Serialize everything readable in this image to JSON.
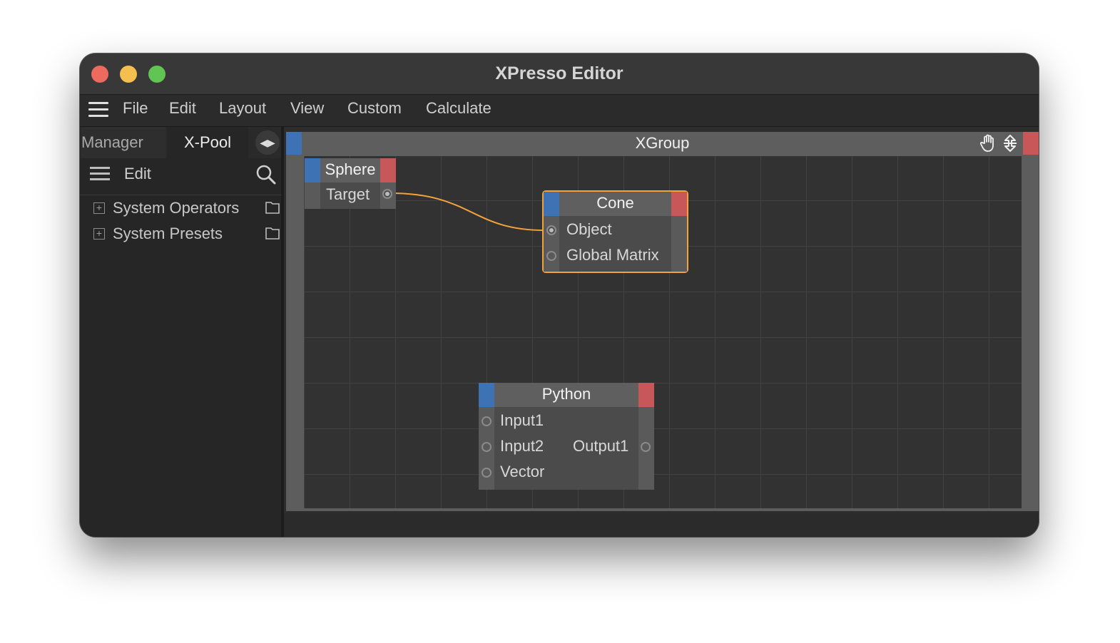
{
  "window": {
    "title": "XPresso Editor"
  },
  "menu": {
    "items": [
      "File",
      "Edit",
      "Layout",
      "View",
      "Custom",
      "Calculate"
    ]
  },
  "left_panel": {
    "tabs": {
      "manager": "Manager",
      "xpool": "X-Pool"
    },
    "edit_label": "Edit",
    "tree": [
      {
        "label": "System Operators"
      },
      {
        "label": "System Presets"
      }
    ]
  },
  "canvas": {
    "group_title": "XGroup",
    "nodes": {
      "sphere": {
        "title": "Sphere",
        "ports": {
          "target": "Target"
        }
      },
      "cone": {
        "title": "Cone",
        "ports": {
          "object": "Object",
          "global_matrix": "Global Matrix"
        }
      },
      "python": {
        "title": "Python",
        "inputs": [
          "Input1",
          "Input2",
          "Vector"
        ],
        "outputs": [
          "Output1"
        ]
      }
    },
    "colors": {
      "port_input": "#3d73b5",
      "port_output": "#c8575a",
      "wire": "#f2a33a",
      "selection": "#f2a33a"
    }
  }
}
